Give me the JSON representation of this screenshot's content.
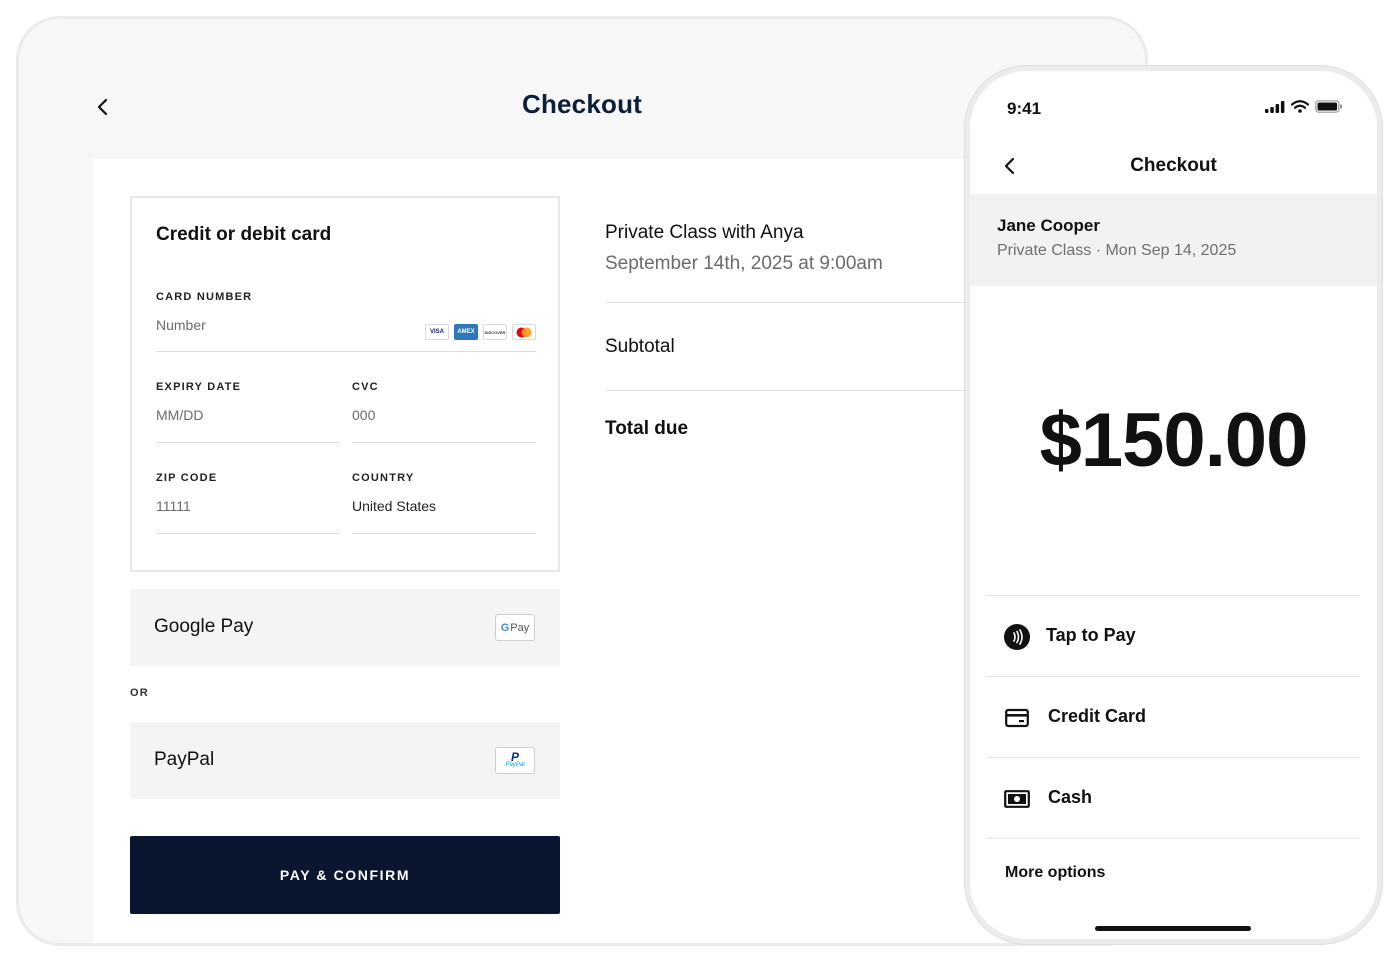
{
  "tablet": {
    "title": "Checkout",
    "card_section": {
      "title": "Credit or debit card",
      "card_number": {
        "label": "CARD NUMBER",
        "placeholder": "Number",
        "brands": [
          "VISA",
          "AMEX",
          "DISCOVER",
          "MASTERCARD"
        ]
      },
      "expiry": {
        "label": "EXPIRY DATE",
        "placeholder": "MM/DD"
      },
      "cvc": {
        "label": "CVC",
        "placeholder": "000"
      },
      "zip": {
        "label": "ZIP CODE",
        "placeholder": "11111"
      },
      "country": {
        "label": "COUNTRY",
        "value": "United States"
      }
    },
    "google_pay": {
      "label": "Google Pay",
      "badge": "G Pay"
    },
    "or_text": "OR",
    "paypal": {
      "label": "PayPal",
      "badge": "PayPal"
    },
    "pay_button": "PAY & CONFIRM",
    "summary": {
      "item_name": "Private Class with Anya",
      "item_date": "September 14th, 2025 at 9:00am",
      "subtotal_label": "Subtotal",
      "total_label": "Total due"
    }
  },
  "phone": {
    "status_time": "9:41",
    "title": "Checkout",
    "customer_name": "Jane Cooper",
    "customer_detail": "Private Class · Mon Sep 14, 2025",
    "amount": "$150.00",
    "options": [
      {
        "label": "Tap to Pay",
        "icon": "contactless-icon"
      },
      {
        "label": "Credit Card",
        "icon": "credit-card-icon"
      },
      {
        "label": "Cash",
        "icon": "cash-icon"
      }
    ],
    "more_options": "More options"
  },
  "colors": {
    "primary_dark": "#0a1530",
    "title_navy": "#0b1f3a",
    "muted_text": "#6b6b6b",
    "panel_bg": "#f7f7f7"
  }
}
